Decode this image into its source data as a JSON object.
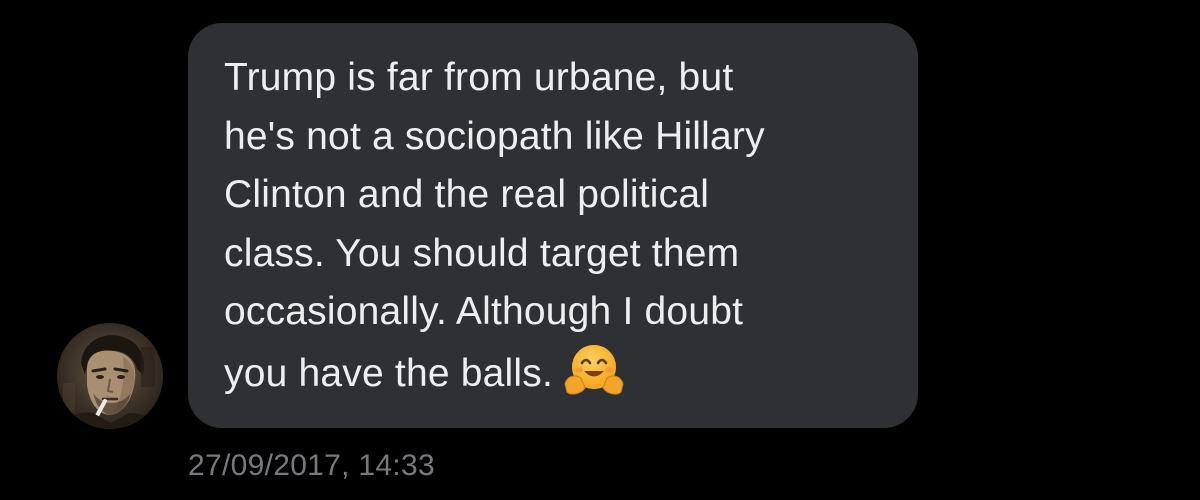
{
  "message": {
    "lines": [
      "Trump is far from urbane, but",
      "he's not a sociopath like Hillary",
      "Clinton and the real political",
      "class. You should target them",
      "occasionally. Although I doubt",
      "you have the balls."
    ],
    "emoji": "hugging-face-emoji",
    "timestamp": "27/09/2017, 14:33"
  },
  "colors": {
    "background": "#000000",
    "bubble": "#2e3033",
    "text": "#eceef0",
    "timestamp": "#76797d"
  }
}
